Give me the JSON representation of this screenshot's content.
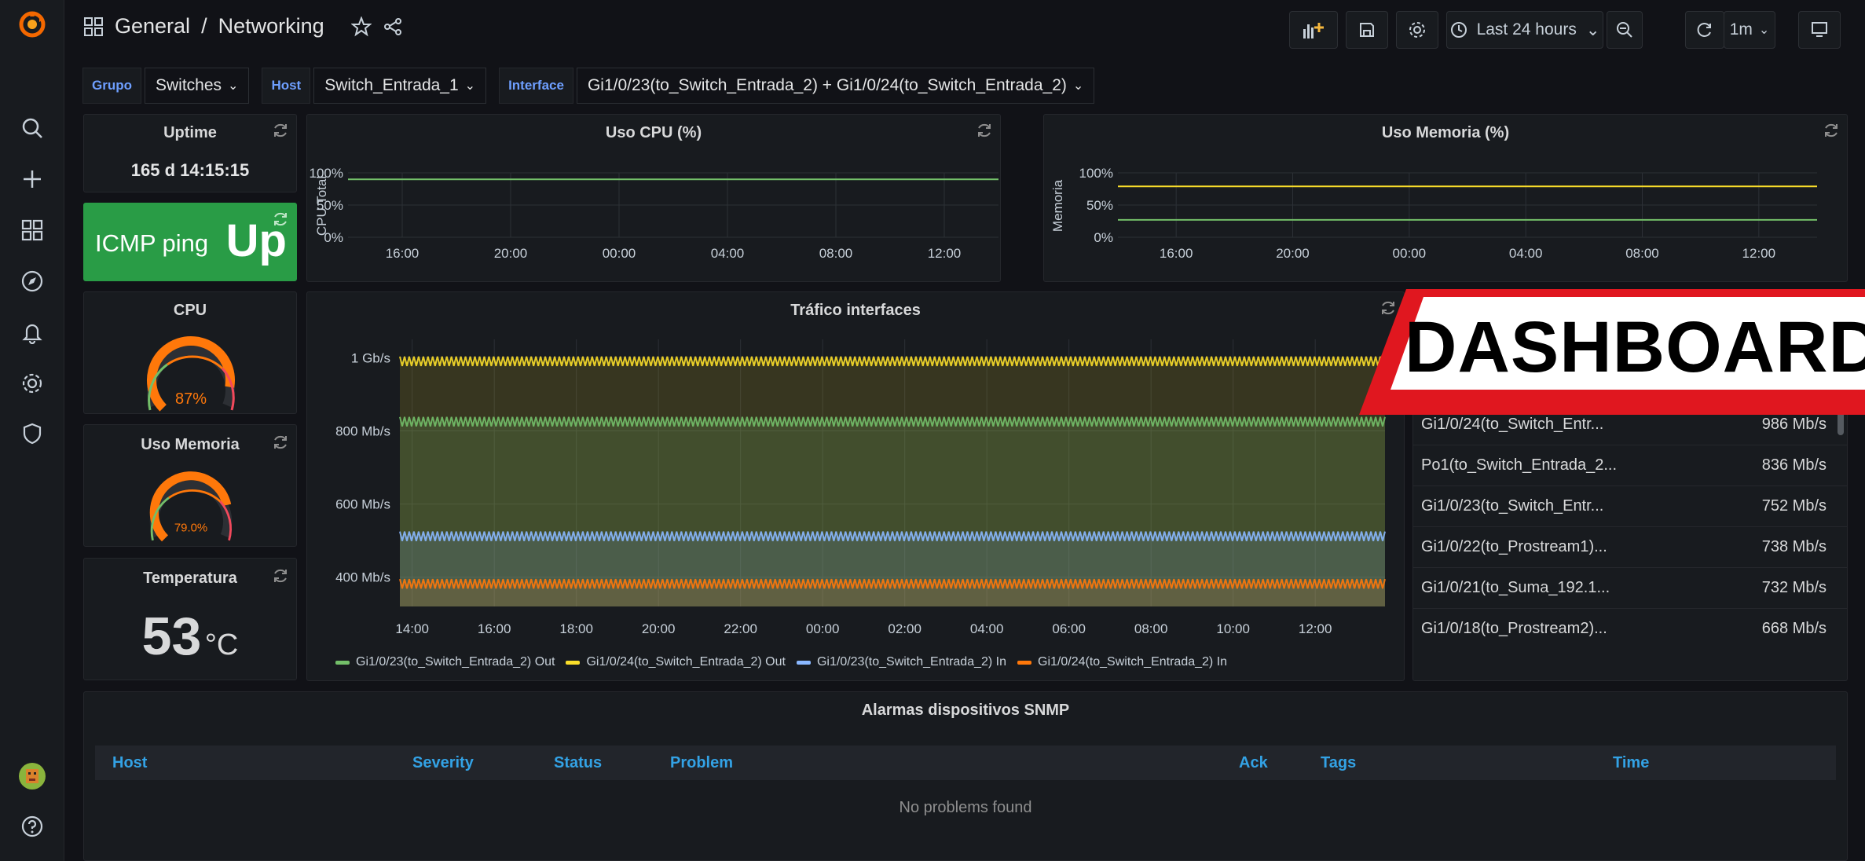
{
  "breadcrumb": {
    "folder": "General",
    "separator": "/",
    "dashboard": "Networking"
  },
  "toolbar": {
    "time_range": "Last 24 hours",
    "refresh_interval": "1m"
  },
  "variables": [
    {
      "label": "Grupo",
      "value": "Switches"
    },
    {
      "label": "Host",
      "value": "Switch_Entrada_1"
    },
    {
      "label": "Interface",
      "value": "Gi1/0/23(to_Switch_Entrada_2) + Gi1/0/24(to_Switch_Entrada_2)"
    }
  ],
  "uptime": {
    "title": "Uptime",
    "value": "165 d 14:15:15"
  },
  "icmp": {
    "label": "ICMP ping",
    "status": "Up",
    "color": "#299c46"
  },
  "cpu_gauge": {
    "title": "CPU",
    "value": "87%",
    "percent": 87
  },
  "mem_gauge": {
    "title": "Uso Memoria",
    "value": "79.0%",
    "percent": 79
  },
  "temperature": {
    "title": "Temperatura",
    "value": "53",
    "unit": "°C"
  },
  "colors": {
    "accent": "#ff7f1a",
    "green": "#73bf69",
    "yellow": "#fade2a",
    "blue": "#8ab8ff",
    "orange": "#ff780a"
  },
  "chart_data": [
    {
      "type": "line",
      "title": "Uso CPU (%)",
      "ylabel": "CPU Total",
      "yticks": [
        "100%",
        "50%",
        "0%"
      ],
      "ylim": [
        0,
        100
      ],
      "x": [
        "16:00",
        "20:00",
        "00:00",
        "04:00",
        "08:00",
        "12:00"
      ],
      "series": [
        {
          "values": [
            90,
            90,
            90,
            90,
            90,
            90
          ]
        }
      ]
    },
    {
      "type": "line",
      "title": "Uso Memoria (%)",
      "ylabel": "Memoria",
      "yticks": [
        "100%",
        "50%",
        "0%"
      ],
      "ylim": [
        0,
        100
      ],
      "x": [
        "16:00",
        "20:00",
        "00:00",
        "04:00",
        "08:00",
        "12:00"
      ],
      "series": [
        {
          "values": [
            79,
            79,
            79,
            79,
            79,
            79
          ]
        },
        {
          "values": [
            27,
            27,
            27,
            27,
            27,
            27
          ]
        }
      ]
    },
    {
      "type": "area",
      "title": "Tráfico interfaces",
      "yticks": [
        "1 Gb/s",
        "800 Mb/s",
        "600 Mb/s",
        "400 Mb/s"
      ],
      "ylim": [
        320,
        1050
      ],
      "x": [
        "14:00",
        "16:00",
        "18:00",
        "20:00",
        "22:00",
        "00:00",
        "02:00",
        "04:00",
        "06:00",
        "08:00",
        "10:00",
        "12:00"
      ],
      "series": [
        {
          "name": "Gi1/0/23(to_Switch_Entrada_2) Out",
          "values": [
            825,
            825,
            825,
            825,
            825,
            825,
            825,
            825,
            825,
            825,
            825,
            825
          ]
        },
        {
          "name": "Gi1/0/24(to_Switch_Entrada_2) Out",
          "values": [
            990,
            990,
            990,
            990,
            990,
            990,
            990,
            990,
            990,
            990,
            990,
            990
          ]
        },
        {
          "name": "Gi1/0/23(to_Switch_Entrada_2) In",
          "values": [
            512,
            512,
            512,
            512,
            512,
            512,
            512,
            512,
            512,
            512,
            512,
            512
          ]
        },
        {
          "name": "Gi1/0/24(to_Switch_Entrada_2) In",
          "values": [
            382,
            382,
            382,
            382,
            382,
            382,
            382,
            382,
            382,
            382,
            382,
            382
          ]
        }
      ]
    }
  ],
  "top_interfaces": [
    {
      "name": "Gi1/0/24(to_Switch_Entr...",
      "value": "986 Mb/s"
    },
    {
      "name": "Po1(to_Switch_Entrada_2...",
      "value": "836 Mb/s"
    },
    {
      "name": "Gi1/0/23(to_Switch_Entr...",
      "value": "752 Mb/s"
    },
    {
      "name": "Gi1/0/22(to_Prostream1)...",
      "value": "738 Mb/s"
    },
    {
      "name": "Gi1/0/21(to_Suma_192.1...",
      "value": "732 Mb/s"
    },
    {
      "name": "Gi1/0/18(to_Prostream2)...",
      "value": "668 Mb/s"
    }
  ],
  "alarms": {
    "title": "Alarmas dispositivos SNMP",
    "columns": [
      "Host",
      "Severity",
      "Status",
      "Problem",
      "Ack",
      "Tags",
      "Time"
    ],
    "empty": "No problems found"
  },
  "overlay": {
    "text": "DASHBOARD"
  }
}
